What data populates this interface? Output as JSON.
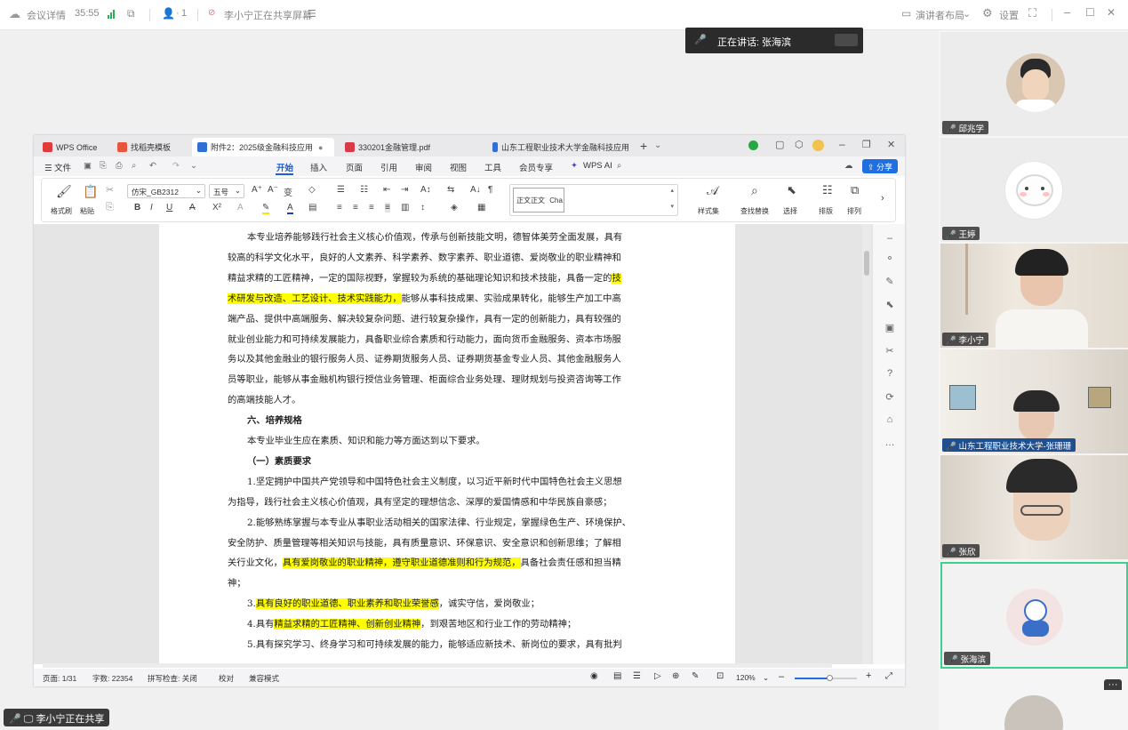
{
  "meeting_bar": {
    "meeting_details": "会议详情",
    "duration": "35:55",
    "participant_count": "1",
    "sharing_status": "李小宁正在共享屏幕",
    "speaker_layout": "演讲者布局",
    "settings": "设置"
  },
  "speaker": {
    "prefix": "正在讲话:",
    "name": "张海滨"
  },
  "wps": {
    "tabs": [
      {
        "label": "WPS Office"
      },
      {
        "label": "找稻壳模板"
      },
      {
        "label": "附件2：2025级金融科技应用"
      },
      {
        "label": "330201金融管理.pdf"
      },
      {
        "label": "山东工程职业技术大学金融科技应用"
      }
    ],
    "menu": {
      "file": "文件",
      "items": [
        "开始",
        "插入",
        "页面",
        "引用",
        "审阅",
        "视图",
        "工具",
        "会员专享"
      ],
      "wps_ai": "WPS AI",
      "share": "分享"
    },
    "ribbon": {
      "format_painter": "格式刷",
      "paste": "粘贴",
      "font_name": "仿宋_GB2312",
      "font_size": "五号",
      "style_sample": "正文正文",
      "style_sample2": "Cha",
      "style_set": "样式集",
      "find_replace": "查找替换",
      "select": "选择",
      "layout": "排版",
      "arrange": "排列"
    },
    "doc_lines": [
      [
        {
          "t": "本专业培养能够践行社会主义核心价值观，传承与创新技能文明，德智体美劳全面发展，具有"
        }
      ],
      [
        {
          "t": "较高的科学文化水平，良好的人文素养、科学素养、数字素养、职业道德、爱岗敬业的职业精神和"
        }
      ],
      [
        {
          "t": "精益求精的工匠精神，一定的国际视野，掌握较为系统的基础理论知识和技术技能，具备一定的"
        },
        {
          "t": "技",
          "h": true
        }
      ],
      [
        {
          "t": "术研发与改造、工艺设计、技术实践能力，",
          "h": true
        },
        {
          "t": "能够从事科技成果、实验成果转化，能够生产加工中高"
        }
      ],
      [
        {
          "t": "端产品、提供中高端服务、解决较复杂问题、进行较复杂操作，具有一定的创新能力，具有较强的"
        }
      ],
      [
        {
          "t": "就业创业能力和可持续发展能力，具备职业综合素质和行动能力，面向货币金融服务、资本市场服"
        }
      ],
      [
        {
          "t": "务以及其他金融业的银行服务人员、证券期货服务人员、证券期货基金专业人员、其他金融服务人"
        }
      ],
      [
        {
          "t": "员等职业，能够从事金融机构银行授信业务管理、柜面综合业务处理、理财规划与投资咨询等工作"
        }
      ],
      [
        {
          "t": "的高端技能人才。"
        }
      ],
      [
        {
          "t": "六、培养规格",
          "b": true
        }
      ],
      [
        {
          "t": "本专业毕业生应在素质、知识和能力等方面达到以下要求。"
        }
      ],
      [
        {
          "t": "（一）素质要求",
          "b": true
        }
      ],
      [
        {
          "t": "1.坚定拥护中国共产党领导和中国特色社会主义制度，以习近平新时代中国特色社会主义思想"
        }
      ],
      [
        {
          "t": "为指导，践行社会主义核心价值观，具有坚定的理想信念、深厚的爱国情感和中华民族自豪感；"
        }
      ],
      [
        {
          "t": "2.能够熟练掌握与本专业从事职业活动相关的国家法律、行业规定，掌握绿色生产、环境保护、"
        }
      ],
      [
        {
          "t": "安全防护、质量管理等相关知识与技能，具有质量意识、环保意识、安全意识和创新思维；了解相"
        }
      ],
      [
        {
          "t": "关行业文化，"
        },
        {
          "t": "具有爱岗敬业的职业精神，遵守职业道德准则和行为规范，",
          "h": true
        },
        {
          "t": "具备社会责任感和担当精"
        }
      ],
      [
        {
          "t": "神；"
        }
      ],
      [
        {
          "t": "3."
        },
        {
          "t": "具有良好的职业道德、职业素养和职业荣誉感",
          "h": true
        },
        {
          "t": "，诚实守信，爱岗敬业；"
        }
      ],
      [
        {
          "t": "4.具有"
        },
        {
          "t": "精益求精的工匠精神、创新创业精神",
          "h": true
        },
        {
          "t": "，到艰苦地区和行业工作的劳动精神；"
        }
      ],
      [
        {
          "t": "5.具有探究学习、终身学习和可持续发展的能力，能够适应新技术、新岗位的要求，具有批判"
        }
      ]
    ],
    "status": {
      "page": "页面: 1/31",
      "words": "字数: 22354",
      "spell": "拼写检查: 关闭",
      "proof": "校对",
      "compat": "兼容模式",
      "zoom": "120%"
    }
  },
  "participants": [
    {
      "name": "邱兆学"
    },
    {
      "name": "王婷"
    },
    {
      "name": "李小宁"
    },
    {
      "name": "山东工程职业技术大学-张珊珊"
    },
    {
      "name": "张欣"
    },
    {
      "name": "张海滨"
    }
  ],
  "share_badge": "李小宁正在共享"
}
